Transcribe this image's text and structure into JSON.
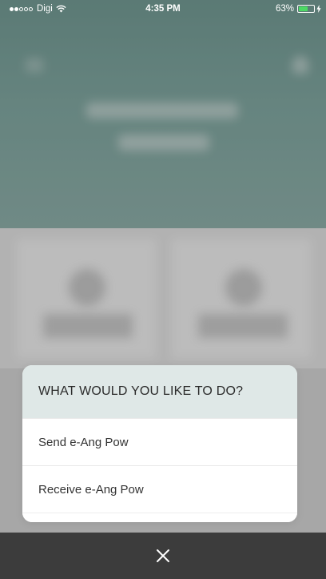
{
  "status_bar": {
    "signal_full": 2,
    "signal_total": 5,
    "carrier": "Digi",
    "time": "4:35 PM",
    "battery_percent_label": "63%",
    "battery_level": 0.63,
    "wifi_icon": "wifi-icon",
    "charge_icon": "charging-icon"
  },
  "action_sheet": {
    "title": "WHAT WOULD YOU LIKE TO DO?",
    "options": [
      {
        "label": "Send e-Ang Pow"
      },
      {
        "label": "Receive e-Ang Pow"
      }
    ]
  },
  "close": {
    "icon": "close-icon"
  },
  "colors": {
    "header_bg": "#6f9a93",
    "sheet_header_bg": "#dfe8e7",
    "battery_green": "#4cd964"
  }
}
